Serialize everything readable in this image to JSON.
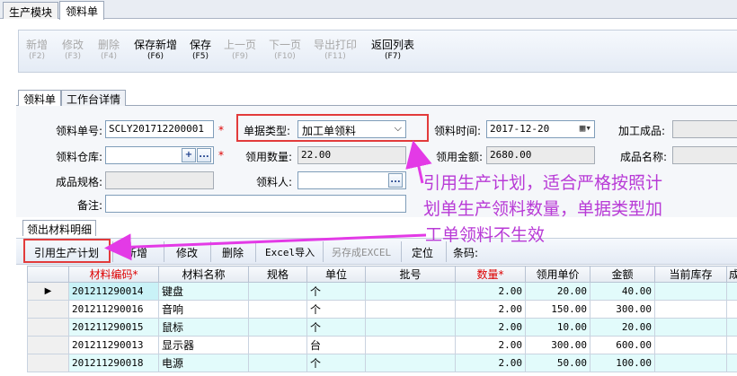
{
  "top_tabs": [
    "生产模块",
    "领料单"
  ],
  "toolbar": [
    {
      "label": "新增",
      "key": "(F2)",
      "enabled": false
    },
    {
      "label": "修改",
      "key": "(F3)",
      "enabled": false
    },
    {
      "label": "删除",
      "key": "(F4)",
      "enabled": false
    },
    {
      "label": "保存新增",
      "key": "(F6)",
      "enabled": true
    },
    {
      "label": "保存",
      "key": "(F5)",
      "enabled": true
    },
    {
      "label": "上一页",
      "key": "(F9)",
      "enabled": false
    },
    {
      "label": "下一页",
      "key": "(F10)",
      "enabled": false
    },
    {
      "label": "导出打印",
      "key": "(F11)",
      "enabled": false
    },
    {
      "label": "返回列表",
      "key": "(F7)",
      "enabled": true
    }
  ],
  "sub_tabs": [
    "领料单",
    "工作台详情"
  ],
  "form": {
    "doc_no_label": "领料单号:",
    "doc_no_value": "SCLY201712200001",
    "doc_type_label": "单据类型:",
    "doc_type_value": "加工单领料",
    "pick_time_label": "领料时间:",
    "pick_time_value": "2017-12-20",
    "processed_product_label": "加工成品:",
    "warehouse_label": "领料仓库:",
    "pick_qty_label": "领用数量:",
    "pick_qty_value": "22.00",
    "pick_amount_label": "领用金额:",
    "pick_amount_value": "2680.00",
    "product_name_label": "成品名称:",
    "product_spec_label": "成品规格:",
    "picker_label": "领料人:",
    "remark_label": "备注:",
    "required_mark": "*",
    "ellipsis": "...",
    "plus": "+"
  },
  "detail": {
    "tab_label": "领出材料明细",
    "buttons": [
      "引用生产计划",
      "新增",
      "修改",
      "删除",
      "Excel导入",
      "另存成EXCEL",
      "定位",
      "条码:"
    ],
    "columns": [
      "材料编码*",
      "材料名称",
      "规格",
      "单位",
      "批号",
      "数量*",
      "领用单价",
      "金额",
      "当前库存",
      "成本"
    ],
    "rows": [
      {
        "code": "201211290014",
        "name": "键盘",
        "spec": "",
        "unit": "个",
        "batch": "",
        "qty": "2.00",
        "price": "20.00",
        "amount": "40.00",
        "stock": ""
      },
      {
        "code": "201211290016",
        "name": "音响",
        "spec": "",
        "unit": "个",
        "batch": "",
        "qty": "2.00",
        "price": "150.00",
        "amount": "300.00",
        "stock": ""
      },
      {
        "code": "201211290015",
        "name": "鼠标",
        "spec": "",
        "unit": "个",
        "batch": "",
        "qty": "2.00",
        "price": "10.00",
        "amount": "20.00",
        "stock": ""
      },
      {
        "code": "201211290013",
        "name": "显示器",
        "spec": "",
        "unit": "台",
        "batch": "",
        "qty": "2.00",
        "price": "300.00",
        "amount": "600.00",
        "stock": ""
      },
      {
        "code": "201211290018",
        "name": "电源",
        "spec": "",
        "unit": "个",
        "batch": "",
        "qty": "2.00",
        "price": "50.00",
        "amount": "100.00",
        "stock": ""
      }
    ],
    "current_row_marker": "▶"
  },
  "annotation": {
    "lines": [
      "引用生产计划，适合严格按照计",
      "划单生产领料数量，单据类型加",
      "工单领料不生效"
    ],
    "color": "#b83ad6"
  }
}
